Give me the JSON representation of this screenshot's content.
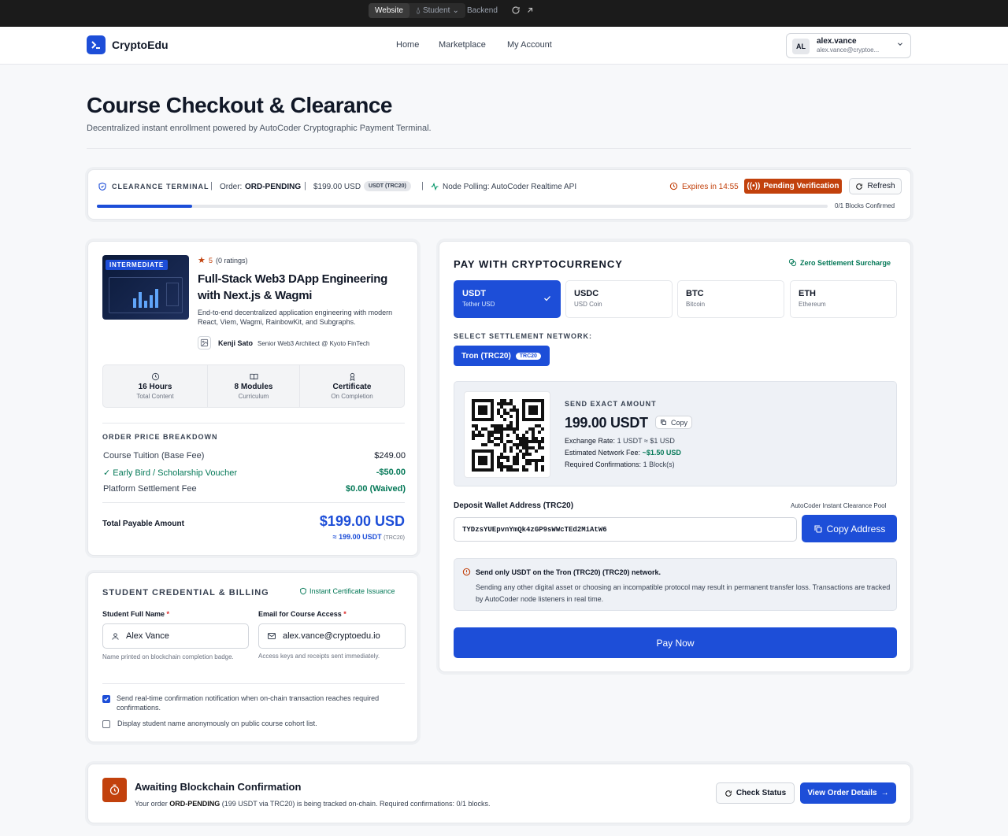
{
  "topbar": {
    "website": "Website",
    "student": "Student",
    "backend": "Backend"
  },
  "header": {
    "brand": "CryptoEdu",
    "nav": [
      "Home",
      "Marketplace",
      "My Account"
    ],
    "user_initials": "AL",
    "username": "alex.vance",
    "email": "alex.vance@cryptoe..."
  },
  "page": {
    "title": "Course Checkout & Clearance",
    "subtitle": "Decentralized instant enrollment powered by AutoCoder Cryptographic Payment Terminal."
  },
  "terminal": {
    "label": "CLEARANCE TERMINAL",
    "order_label": "Order:",
    "order_id": "ORD-PENDING",
    "amount": "$199.00 USD",
    "token_badge": "USDT (TRC20)",
    "polling": "Node Polling: AutoCoder Realtime API",
    "expires": "Expires in 14:55",
    "status": "Pending Verification",
    "refresh": "Refresh",
    "blocks": "0/1 Blocks Confirmed",
    "progress": 0.13
  },
  "course": {
    "level": "INTERMEDIATE",
    "rating": "5",
    "ratings_count": "(0 ratings)",
    "title": "Full-Stack Web3 DApp Engineering with Next.js & Wagmi",
    "description": "End-to-end decentralized application engineering with modern React, Viem, Wagmi, RainbowKit, and Subgraphs.",
    "instructor": "Kenji Sato",
    "instructor_role": "Senior Web3 Architect @ Kyoto FinTech",
    "stats": [
      {
        "value": "16 Hours",
        "label": "Total Content"
      },
      {
        "value": "8 Modules",
        "label": "Curriculum"
      },
      {
        "value": "Certificate",
        "label": "On Completion"
      }
    ]
  },
  "breakdown": {
    "heading": "ORDER PRICE BREAKDOWN",
    "rows": [
      {
        "label": "Course Tuition (Base Fee)",
        "value": "$249.00"
      },
      {
        "label": "Early Bird / Scholarship Voucher",
        "value": "-$50.00"
      },
      {
        "label": "Platform Settlement Fee",
        "value": "$0.00 (Waived)"
      }
    ],
    "total_label": "Total Payable Amount",
    "total": "$199.00 USD",
    "total_crypto": "≈ 199.00 USDT",
    "total_network": "(TRC20)"
  },
  "billing": {
    "heading": "STUDENT CREDENTIAL & BILLING",
    "badge": "Instant Certificate Issuance",
    "name_label": "Student Full Name",
    "name_value": "Alex Vance",
    "name_hint": "Name printed on blockchain completion badge.",
    "email_label": "Email for Course Access",
    "email_value": "alex.vance@cryptoedu.io",
    "email_hint": "Access keys and receipts sent immediately.",
    "check1": "Send real-time confirmation notification when on-chain transaction reaches required confirmations.",
    "check2": "Display student name anonymously on public course cohort list.",
    "check1_on": true,
    "check2_on": false
  },
  "payment": {
    "heading": "PAY WITH CRYPTOCURRENCY",
    "badge": "Zero Settlement Surcharge",
    "tokens": [
      {
        "symbol": "USDT",
        "name": "Tether USD"
      },
      {
        "symbol": "USDC",
        "name": "USD Coin"
      },
      {
        "symbol": "BTC",
        "name": "Bitcoin"
      },
      {
        "symbol": "ETH",
        "name": "Ethereum"
      }
    ],
    "network_label": "SELECT SETTLEMENT NETWORK:",
    "network": "Tron (TRC20)",
    "network_badge": "TRC20",
    "send_label": "SEND EXACT AMOUNT",
    "send_amount": "199.00 USDT",
    "copy": "Copy",
    "rate_label": "Exchange Rate:",
    "rate": "1 USDT ≈ $1 USD",
    "fee_label": "Estimated Network Fee:",
    "fee": "~$1.50 USD",
    "conf_label": "Required Confirmations:",
    "conf": "1 Block(s)",
    "address_label": "Deposit Wallet Address (TRC20)",
    "pool": "AutoCoder Instant Clearance Pool",
    "address": "TYDzsYUEpvnYmQk4zGP9sWWcTEd2MiAtW6",
    "copy_address": "Copy Address",
    "warn_title": "Send only USDT on the Tron (TRC20) (TRC20) network.",
    "warn_body": "Sending any other digital asset or choosing an incompatible protocol may result in permanent transfer loss. Transactions are tracked by AutoCoder node listeners in real time.",
    "pay": "Pay Now"
  },
  "await": {
    "title": "Awaiting Blockchain Confirmation",
    "text_pre": "Your order ",
    "order": "ORD-PENDING",
    "text_post": " (199 USDT via TRC20) is being tracked on-chain. Required confirmations: 0/1 blocks.",
    "check_status": "Check Status",
    "view_order": "View Order Details"
  },
  "colors": {
    "primary": "#1d4ed8",
    "warning": "#c2410c",
    "success": "#047857"
  }
}
